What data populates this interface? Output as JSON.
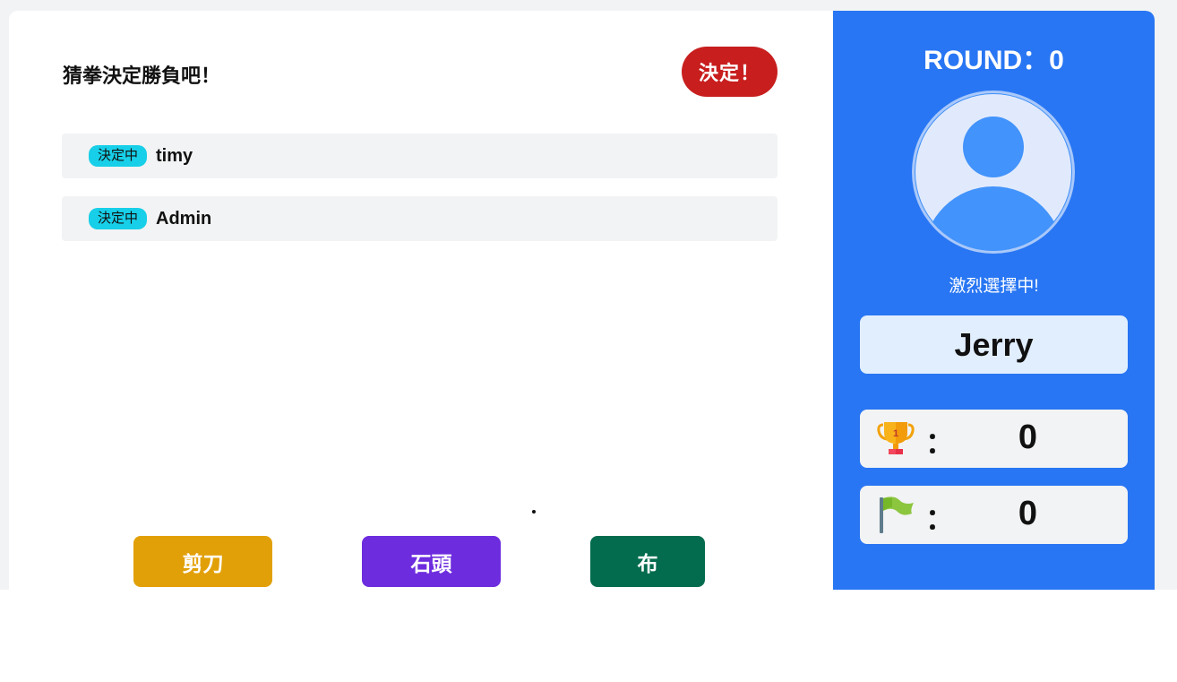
{
  "game": {
    "title": "猜拳決定勝負吧",
    "title_mark": "！",
    "decide_label": "決定！"
  },
  "players": [
    {
      "status": "決定中",
      "name": "timy"
    },
    {
      "status": "決定中",
      "name": "Admin"
    }
  ],
  "choices": {
    "scissors": "剪刀",
    "rock": "石頭",
    "paper": "布"
  },
  "side": {
    "round_label": "ROUND：0",
    "status": "激烈選擇中!",
    "player_name": "Jerry",
    "wins_icon": "trophy-icon",
    "wins_colon": "：",
    "wins": "0",
    "flags_icon": "flag-icon",
    "flags_colon": "：",
    "flags": "0"
  },
  "colors": {
    "decide": "#c81e1e",
    "badge": "#17cfe8",
    "scissors": "#e2a008",
    "rock": "#6d2cde",
    "paper": "#046c4e",
    "sidebar": "#2876f3"
  }
}
